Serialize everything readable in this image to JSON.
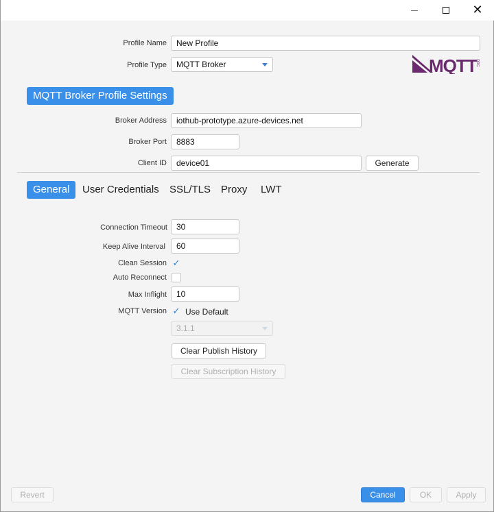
{
  "window": {
    "minimize_label": "",
    "maximize_label": "",
    "close_symbol": "✕"
  },
  "profile": {
    "name_label": "Profile Name",
    "name_value": "New Profile",
    "type_label": "Profile Type",
    "type_value": "MQTT Broker",
    "logo_text": "MQTT",
    "logo_subtext": "ORG"
  },
  "broker": {
    "section_title": "MQTT Broker Profile Settings",
    "address_label": "Broker Address",
    "address_value": "iothub-prototype.azure-devices.net",
    "port_label": "Broker Port",
    "port_value": "8883",
    "client_id_label": "Client ID",
    "client_id_value": "device01",
    "generate_label": "Generate"
  },
  "tabs": [
    {
      "label": "General",
      "active": true
    },
    {
      "label": "User Credentials",
      "active": false
    },
    {
      "label": "SSL/TLS",
      "active": false
    },
    {
      "label": "Proxy",
      "active": false
    },
    {
      "label": "LWT",
      "active": false
    }
  ],
  "general": {
    "connection_timeout_label": "Connection Timeout",
    "connection_timeout_value": "30",
    "keep_alive_label": "Keep Alive Interval",
    "keep_alive_value": "60",
    "clean_session_label": "Clean Session",
    "clean_session_checked": true,
    "auto_reconnect_label": "Auto Reconnect",
    "auto_reconnect_checked": false,
    "max_inflight_label": "Max Inflight",
    "max_inflight_value": "10",
    "mqtt_version_label": "MQTT Version",
    "use_default_label": "Use Default",
    "use_default_checked": true,
    "version_value": "3.1.1",
    "clear_publish_label": "Clear Publish History",
    "clear_subscription_label": "Clear Subscription History"
  },
  "footer": {
    "revert_label": "Revert",
    "cancel_label": "Cancel",
    "ok_label": "OK",
    "apply_label": "Apply"
  },
  "colors": {
    "accent": "#3a8fe8",
    "logo_purple": "#6b2a6e"
  },
  "icons": {
    "check": "✓"
  }
}
